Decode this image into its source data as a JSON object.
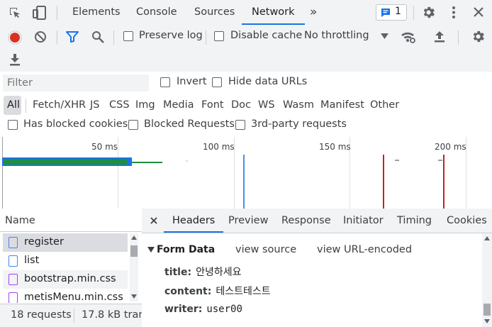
{
  "tabs": [
    "Elements",
    "Console",
    "Sources",
    "Network"
  ],
  "active_tab": "Network",
  "more_tabs_glyph": "»",
  "issues_badge": {
    "count": "1",
    "icon": "message-icon"
  },
  "toolbar": {
    "preserve_log": "Preserve log",
    "disable_cache": "Disable cache",
    "throttling": "No throttling"
  },
  "filter": {
    "placeholder": "Filter",
    "invert": "Invert",
    "hide_data_urls": "Hide data URLs",
    "types": [
      "All",
      "Fetch/XHR",
      "JS",
      "CSS",
      "Img",
      "Media",
      "Font",
      "Doc",
      "WS",
      "Wasm",
      "Manifest",
      "Other"
    ],
    "has_blocked_cookies": "Has blocked cookies",
    "blocked_requests": "Blocked Requests",
    "third_party": "3rd-party requests"
  },
  "overview": {
    "ticks": [
      "50 ms",
      "100 ms",
      "150 ms",
      "200 ms"
    ]
  },
  "requests": {
    "header": "Name",
    "items": [
      {
        "name": "register",
        "type": "document"
      },
      {
        "name": "list",
        "type": "document"
      },
      {
        "name": "bootstrap.min.css",
        "type": "stylesheet"
      },
      {
        "name": "metisMenu.min.css",
        "type": "stylesheet"
      }
    ],
    "summary_count": "18 requests",
    "summary_size": "17.8 kB trans"
  },
  "details": {
    "tabs": [
      "Headers",
      "Preview",
      "Response",
      "Initiator",
      "Timing",
      "Cookies"
    ],
    "active": "Headers",
    "section_title": "Form Data",
    "view_source": "view source",
    "view_url_encoded": "view URL-encoded",
    "fields": [
      {
        "key": "title:",
        "value": "안녕하세요"
      },
      {
        "key": "content:",
        "value": "테스트테스트"
      },
      {
        "key": "writer:",
        "value": "user00"
      }
    ]
  },
  "colors": {
    "accent": "#1a73e8",
    "record": "#d93025",
    "css_icon": "#a142f4",
    "doc_icon": "#4285f4"
  }
}
